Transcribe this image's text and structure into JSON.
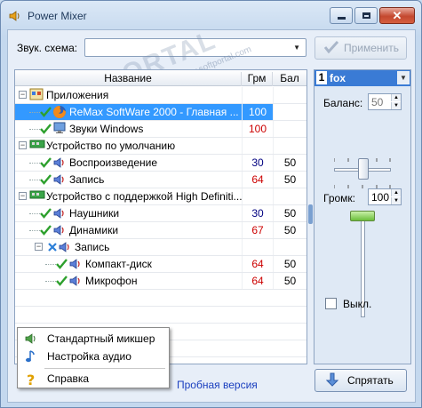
{
  "window": {
    "title": "Power Mixer"
  },
  "watermark": {
    "text": "PORTAL",
    "sub": "www.softportal.com"
  },
  "scheme": {
    "label": "Звук. схема:",
    "value": "",
    "apply_label": "Применить"
  },
  "columns": {
    "name": "Название",
    "grm": "Грм",
    "bal": "Бал"
  },
  "rows": [
    {
      "label": "Приложения",
      "grm": "",
      "bal": "",
      "level": 0,
      "icon": "applications-icon",
      "expander": "−",
      "checked": false
    },
    {
      "label": "ReMax SoftWare 2000 - Главная ...",
      "grm": "100",
      "bal": "",
      "level": 1,
      "icon": "firefox-icon",
      "checked": true,
      "selected": true,
      "grm_color": "red"
    },
    {
      "label": "Звуки Windows",
      "grm": "100",
      "bal": "",
      "level": 1,
      "icon": "windows-sounds-icon",
      "checked": true,
      "grm_color": "red"
    },
    {
      "label": "Устройство по умолчанию",
      "grm": "",
      "bal": "",
      "level": 0,
      "icon": "sound-card-icon",
      "expander": "−",
      "checked": false
    },
    {
      "label": "Воспроизведение",
      "grm": "30",
      "bal": "50",
      "level": 1,
      "icon": "speaker-icon",
      "checked": true,
      "grm_color": "navy"
    },
    {
      "label": "Запись",
      "grm": "64",
      "bal": "50",
      "level": 1,
      "icon": "speaker-icon",
      "checked": true,
      "grm_color": "red"
    },
    {
      "label": "Устройство с поддержкой High Definiti...",
      "grm": "",
      "bal": "",
      "level": 0,
      "icon": "sound-card-icon",
      "expander": "−",
      "checked": false
    },
    {
      "label": "Наушники",
      "grm": "30",
      "bal": "50",
      "level": 1,
      "icon": "speaker-icon",
      "checked": true,
      "grm_color": "navy"
    },
    {
      "label": "Динамики",
      "grm": "67",
      "bal": "50",
      "level": 1,
      "icon": "speaker-icon",
      "checked": true,
      "grm_color": "red"
    },
    {
      "label": "Запись",
      "grm": "",
      "bal": "",
      "level": 1,
      "icon": "speaker-icon",
      "expander": "−",
      "cross": true
    },
    {
      "label": "Компакт-диск",
      "grm": "64",
      "bal": "50",
      "level": 2,
      "icon": "speaker-icon",
      "checked": true,
      "grm_color": "red"
    },
    {
      "label": "Микрофон",
      "grm": "64",
      "bal": "50",
      "level": 2,
      "icon": "speaker-icon",
      "checked": true,
      "grm_color": "red"
    }
  ],
  "channel": {
    "number": "1",
    "name": "fox"
  },
  "balance": {
    "label": "Баланс:",
    "value": "50"
  },
  "volume": {
    "label": "Громк:",
    "value": "100"
  },
  "mute": {
    "label": "Выкл."
  },
  "footer": {
    "trial_link": "Пробная версия",
    "hide_label": "Спрятать"
  },
  "context_menu": {
    "items": [
      {
        "label": "Стандартный микшер",
        "icon": "mixer-icon"
      },
      {
        "label": "Настройка аудио",
        "icon": "music-note-icon"
      },
      {
        "label": "Справка",
        "icon": "help-icon"
      }
    ]
  },
  "colors": {
    "accent": "#3399ff",
    "channel_bar": "#3a7bd5",
    "value_red": "#cc0000",
    "value_navy": "#000080"
  }
}
